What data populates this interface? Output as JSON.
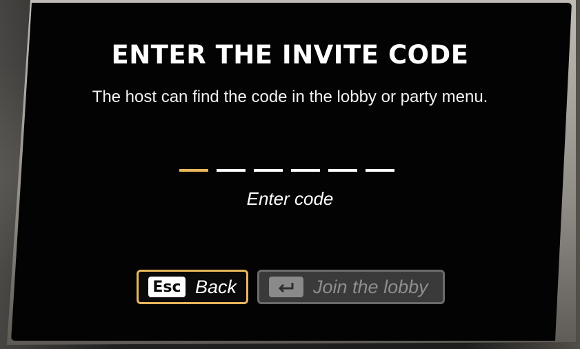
{
  "dialog": {
    "title": "ENTER THE INVITE CODE",
    "subtitle": "The host can find the code in the lobby or party menu.",
    "code": {
      "slot_count": 6,
      "active_slot": 1,
      "hint": "Enter code"
    },
    "buttons": {
      "back": {
        "key": "Esc",
        "label": "Back"
      },
      "join": {
        "key_icon": "enter-key-icon",
        "label": "Join the lobby",
        "enabled": false
      }
    }
  },
  "colors": {
    "accent": "#e8b65c",
    "panel": "#030303",
    "disabled_button": "#3a3a3a",
    "disabled_text": "#8e8e8e"
  }
}
